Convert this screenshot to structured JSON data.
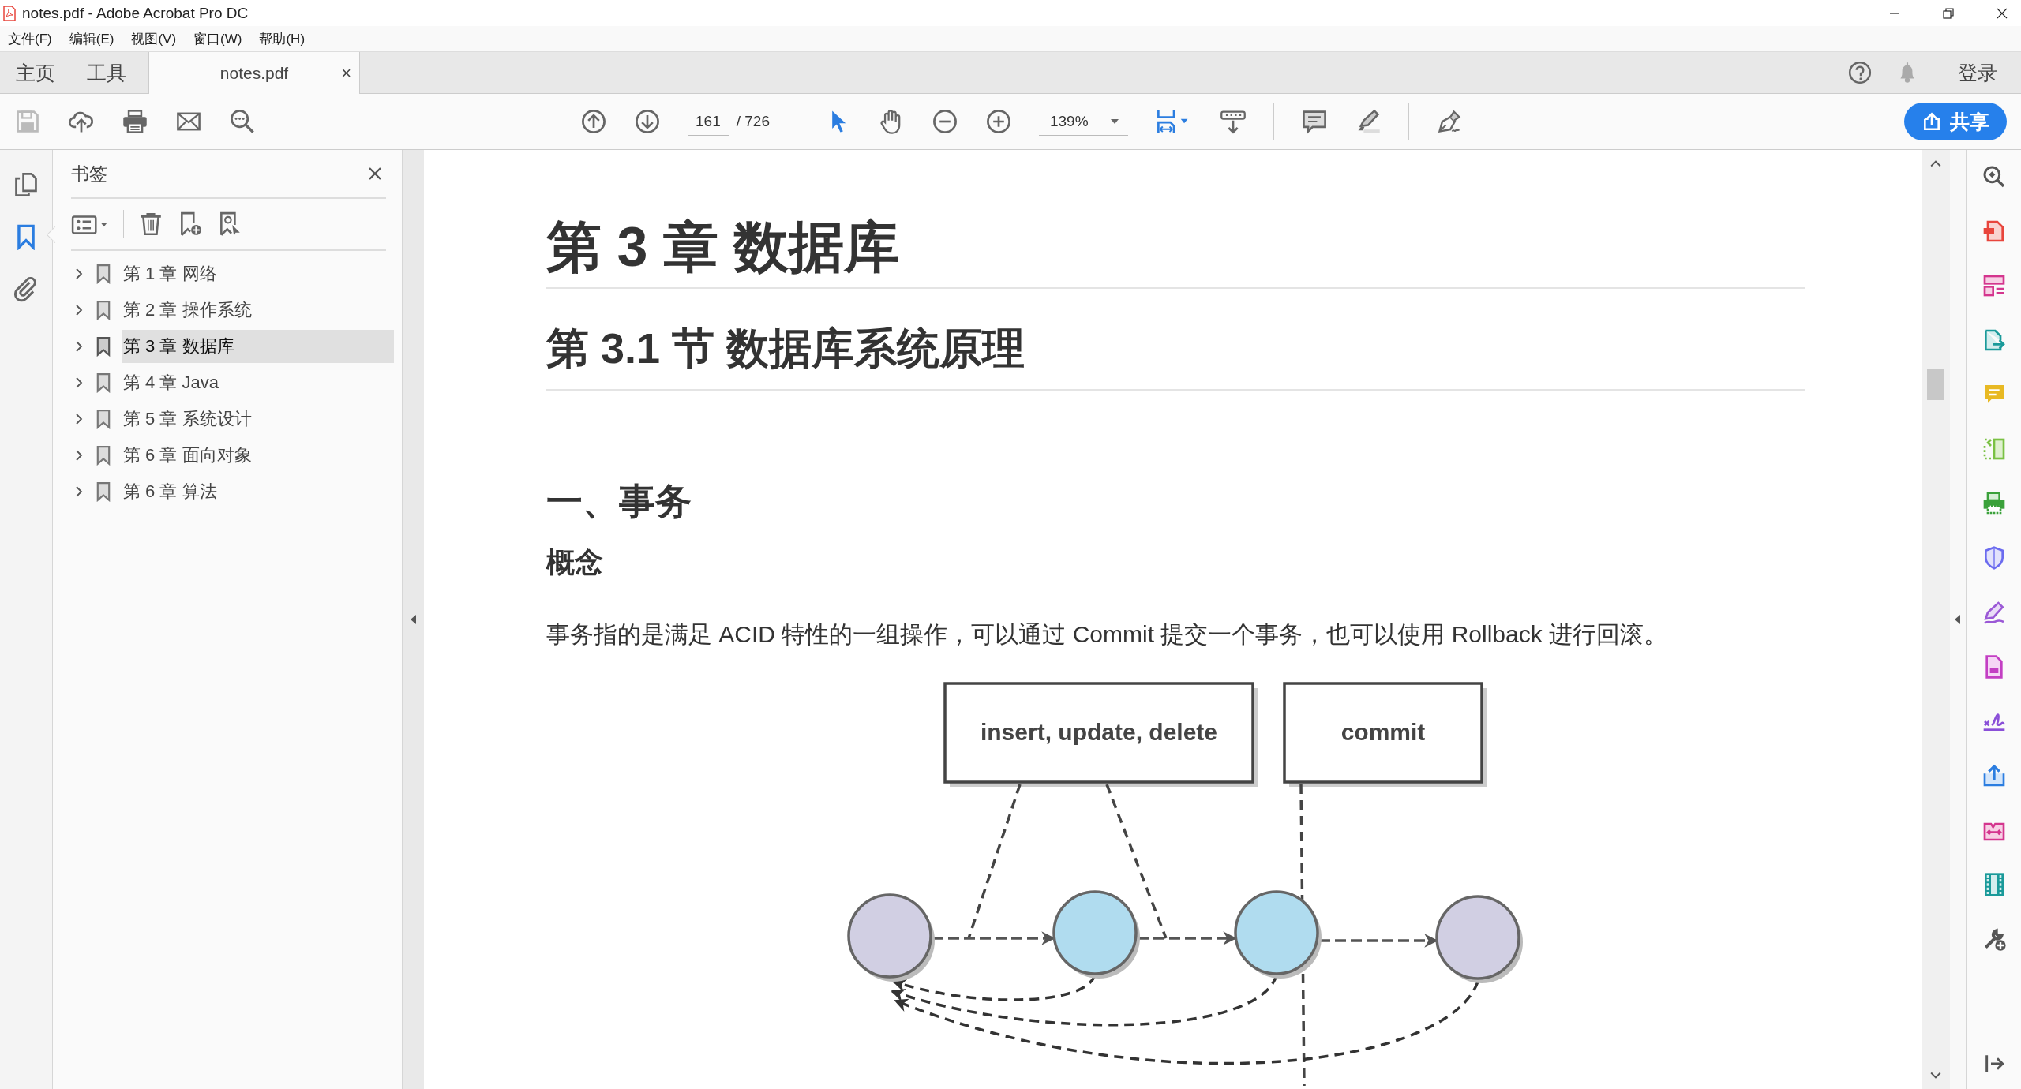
{
  "window": {
    "title": "notes.pdf - Adobe Acrobat Pro DC"
  },
  "menu": [
    "文件(F)",
    "编辑(E)",
    "视图(V)",
    "窗口(W)",
    "帮助(H)"
  ],
  "tabs": [
    {
      "label": "主页",
      "selected": false
    },
    {
      "label": "工具",
      "selected": false
    },
    {
      "label": "notes.pdf",
      "close": "×",
      "selected": true
    }
  ],
  "account": {
    "sign_in": "登录"
  },
  "toolbar": {
    "page": "161",
    "page_total": "/ 726",
    "zoom": "139%",
    "share": "共享"
  },
  "left_rail": [
    {
      "kind": "pages",
      "selected": false
    },
    {
      "kind": "bookmarks",
      "selected": true
    },
    {
      "kind": "attachments",
      "selected": false
    }
  ],
  "sidebar": {
    "title": "书签",
    "bookmarks": [
      {
        "label": "第 1 章 网络",
        "expanded": false,
        "selected": false
      },
      {
        "label": "第 2 章 操作系统",
        "expanded": false,
        "selected": false
      },
      {
        "label": "第 3 章 数据库",
        "expanded": false,
        "selected": true
      },
      {
        "label": "第 4 章 Java",
        "expanded": false,
        "selected": false
      },
      {
        "label": "第 5 章 系统设计",
        "expanded": false,
        "selected": false
      },
      {
        "label": "第 6 章 面向对象",
        "expanded": false,
        "selected": false
      },
      {
        "label": "第 6 章 算法",
        "expanded": false,
        "selected": false
      }
    ]
  },
  "document": {
    "chapter": "第 3 章 数据库",
    "section": "第 3.1 节 数据库系统原理",
    "heading": "一、事务",
    "subheading": "概念",
    "paragraph": "事务指的是满足 ACID 特性的一组操作，可以通过 Commit 提交一个事务，也可以使用 Rollback 进行回滚。",
    "diagram": {
      "boxes": [
        "insert, update, delete",
        "commit"
      ],
      "nodes": [
        {
          "color": "#d1cfe3"
        },
        {
          "color": "#b0dcef"
        },
        {
          "color": "#b0dcef"
        },
        {
          "color": "#d1cfe3"
        }
      ]
    }
  }
}
